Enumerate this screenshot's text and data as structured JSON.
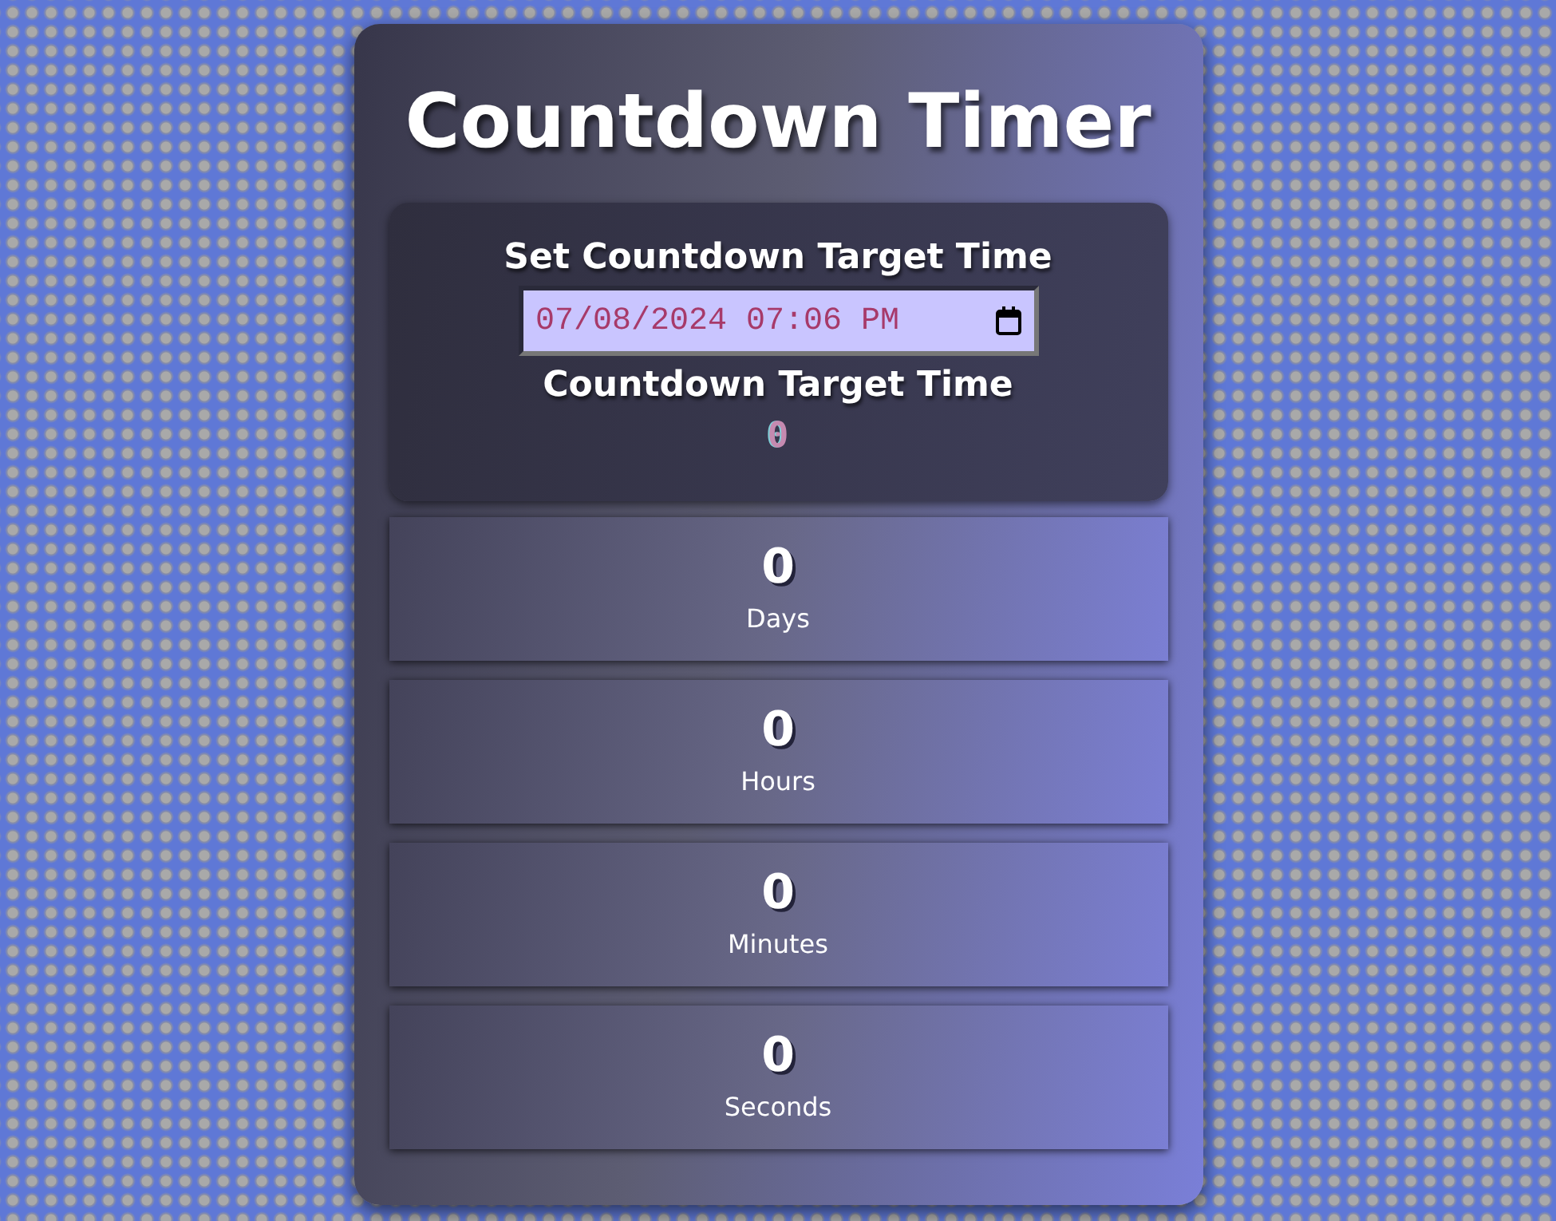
{
  "title": "Countdown Timer",
  "target_panel": {
    "heading": "Set Countdown Target Time",
    "datetime": {
      "value": "07/08/2024 07:06 PM"
    },
    "result_heading": "Countdown Target Time",
    "result_value": "0"
  },
  "counters": [
    {
      "value": "0",
      "label": "Days"
    },
    {
      "value": "0",
      "label": "Hours"
    },
    {
      "value": "0",
      "label": "Minutes"
    },
    {
      "value": "0",
      "label": "Seconds"
    }
  ]
}
